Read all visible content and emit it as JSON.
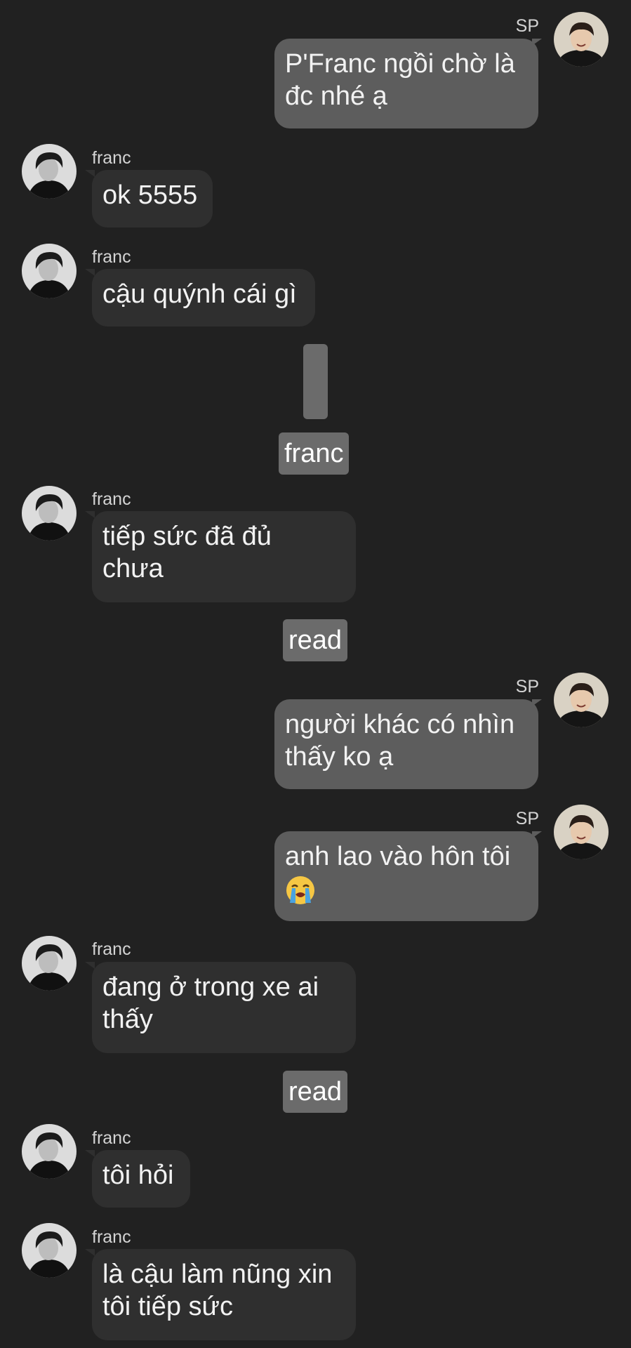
{
  "colors": {
    "background": "#212121",
    "incoming_bubble": "#2f2f2f",
    "outgoing_bubble": "#5d5d5d",
    "system_pill": "#6b6b6b"
  },
  "messages": [
    {
      "sender": "SP",
      "direction": "out",
      "avatar": "sp-avatar",
      "lines": [
        "P'Franc ngồi chờ là",
        "đc nhé ạ"
      ]
    },
    {
      "sender": "franc",
      "direction": "in",
      "avatar": "franc-avatar",
      "lines": [
        "ok 5555"
      ]
    },
    {
      "sender": "franc",
      "direction": "in",
      "avatar": "franc-avatar",
      "lines": [
        "cậu quýnh cái gì"
      ]
    },
    {
      "sender": "franc",
      "direction": "in",
      "avatar": "franc-avatar",
      "lines": [
        "tiếp sức đã đủ",
        "chưa"
      ]
    },
    {
      "sender": "SP",
      "direction": "out",
      "avatar": "sp-avatar",
      "lines": [
        "người khác có nhìn",
        "thấy ko ạ"
      ]
    },
    {
      "sender": "SP",
      "direction": "out",
      "avatar": "sp-avatar",
      "lines": [
        "anh lao vào hôn tôi",
        ""
      ],
      "emoji": "loudly-crying-face"
    },
    {
      "sender": "franc",
      "direction": "in",
      "avatar": "franc-avatar",
      "lines": [
        "đang ở trong xe ai",
        "thấy"
      ]
    },
    {
      "sender": "franc",
      "direction": "in",
      "avatar": "franc-avatar",
      "lines": [
        "tôi hỏi"
      ]
    },
    {
      "sender": "franc",
      "direction": "in",
      "avatar": "franc-avatar",
      "lines": [
        "là cậu làm nũng xin",
        "tôi tiếp sức"
      ]
    }
  ],
  "system_labels": {
    "name_tag": "franc",
    "read_1": "read",
    "read_2": "read"
  }
}
